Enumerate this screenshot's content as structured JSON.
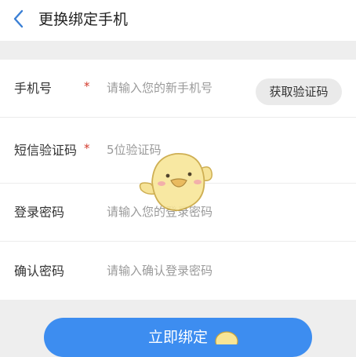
{
  "header": {
    "title": "更换绑定手机",
    "back_icon": "chevron-left-icon"
  },
  "form": {
    "phone": {
      "label": "手机号",
      "required_mark": "*",
      "placeholder": "请输入您的新手机号"
    },
    "code": {
      "label": "短信验证码",
      "required_mark": "*",
      "placeholder": "5位验证码",
      "button_label": "获取验证码"
    },
    "password": {
      "label": "登录密码",
      "placeholder": "请输入您的登录密码"
    },
    "confirm": {
      "label": "确认密码",
      "placeholder": "请输入确认登录密码"
    }
  },
  "submit": {
    "label": "立即绑定"
  },
  "overlay": {
    "icon": "duck-mascot-icon"
  },
  "colors": {
    "accent": "#3d8df0",
    "required": "#d33a2c",
    "placeholder": "#9a9a9a",
    "background": "#eeeeee"
  }
}
